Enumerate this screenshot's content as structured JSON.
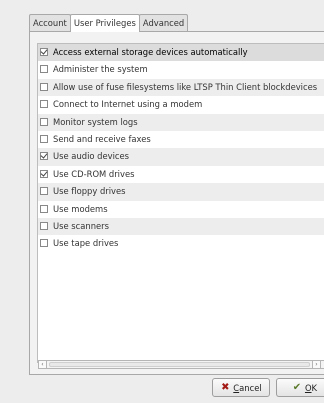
{
  "tabs": [
    {
      "label": "Account",
      "active": false
    },
    {
      "label": "User Privileges",
      "active": true
    },
    {
      "label": "Advanced",
      "active": false
    }
  ],
  "privileges": [
    {
      "label": "Access external storage devices automatically",
      "checked": true
    },
    {
      "label": "Administer the system",
      "checked": false
    },
    {
      "label": "Allow use of fuse filesystems like LTSP Thin Client blockdevices",
      "checked": false
    },
    {
      "label": "Connect to Internet using a modem",
      "checked": false
    },
    {
      "label": "Monitor system logs",
      "checked": false
    },
    {
      "label": "Send and receive faxes",
      "checked": false
    },
    {
      "label": "Use audio devices",
      "checked": true
    },
    {
      "label": "Use CD-ROM drives",
      "checked": true
    },
    {
      "label": "Use floppy drives",
      "checked": false
    },
    {
      "label": "Use modems",
      "checked": false
    },
    {
      "label": "Use scanners",
      "checked": false
    },
    {
      "label": "Use tape drives",
      "checked": false
    }
  ],
  "selected_index": 0,
  "buttons": {
    "cancel": {
      "mnemonic": "C",
      "rest": "ancel",
      "icon": "cancel-x-icon"
    },
    "ok": {
      "mnemonic": "O",
      "rest": "K",
      "icon": "ok-hand-icon"
    }
  }
}
